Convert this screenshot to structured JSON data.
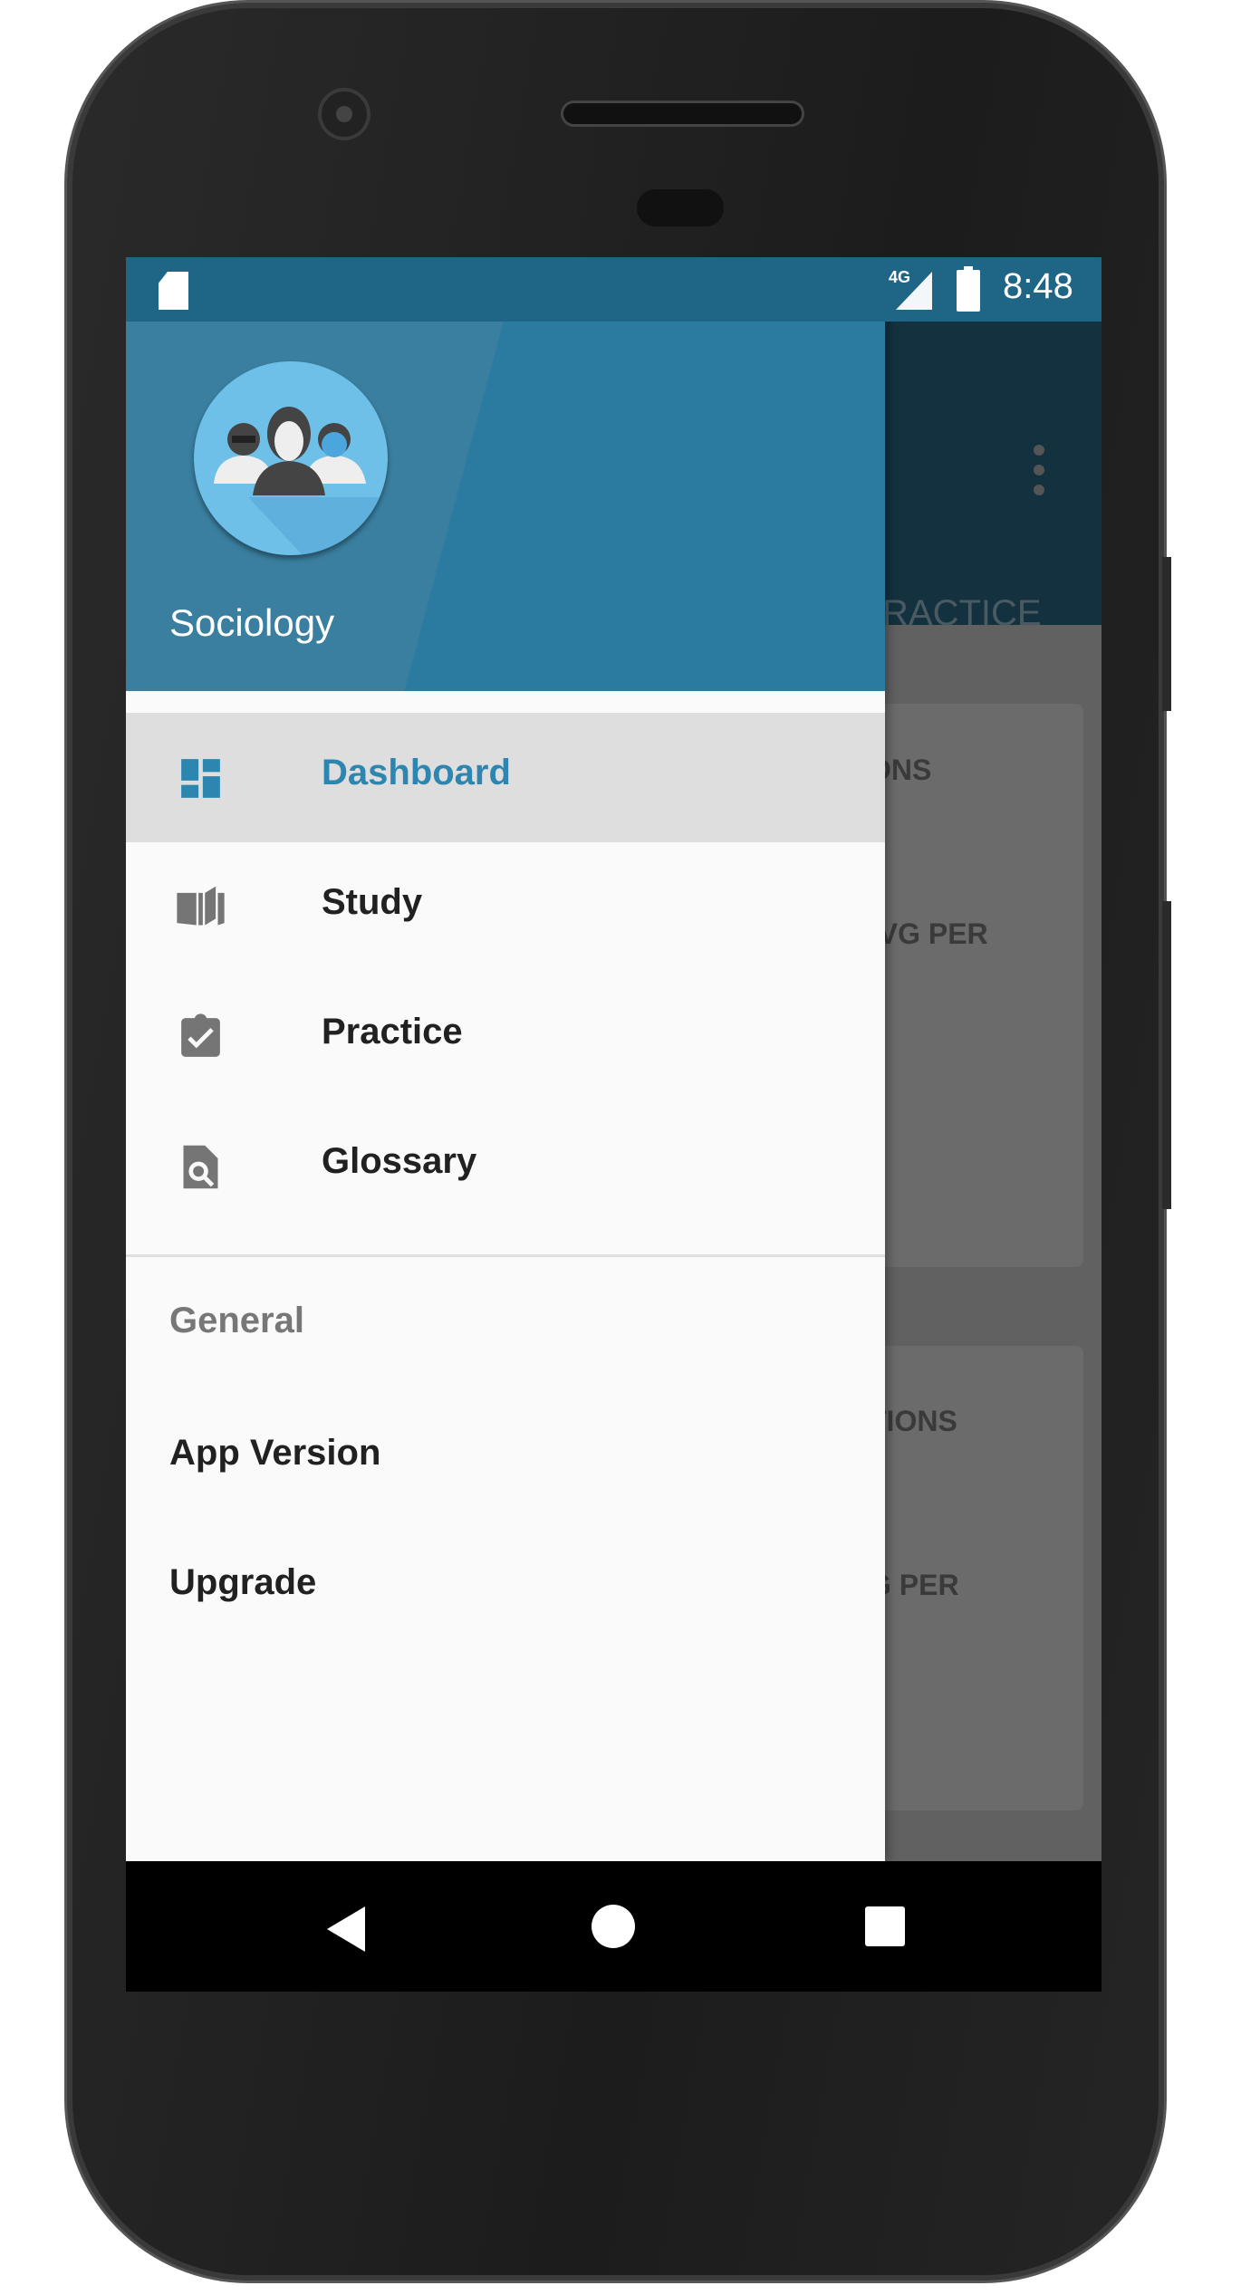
{
  "status_bar": {
    "time": "8:48",
    "network": "4G",
    "icons": [
      "sd-card-icon",
      "signal-icon",
      "battery-charging-icon"
    ]
  },
  "background": {
    "tab_fragment": "RACTICE",
    "cards": [
      {
        "line1": "ONS",
        "line2": "AVG PER"
      },
      {
        "line1": "TIONS",
        "line2": "G PER"
      }
    ]
  },
  "drawer": {
    "app_name": "Sociology",
    "accent": "#2d86b0",
    "header_color": "#2b7aa0",
    "items": [
      {
        "label": "Dashboard",
        "icon": "dashboard-icon",
        "active": true
      },
      {
        "label": "Study",
        "icon": "book-icon",
        "active": false
      },
      {
        "label": "Practice",
        "icon": "clipboard-check-icon",
        "active": false
      },
      {
        "label": "Glossary",
        "icon": "document-search-icon",
        "active": false
      }
    ],
    "section_title": "General",
    "general_items": [
      {
        "label": "App Version"
      },
      {
        "label": "Upgrade"
      }
    ]
  }
}
